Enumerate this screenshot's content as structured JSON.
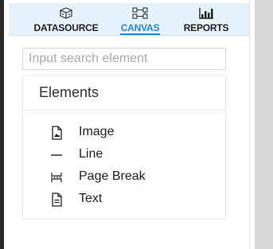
{
  "tabs": [
    {
      "id": "datasource",
      "label": "DATASOURCE",
      "icon": "database-icon",
      "active": false
    },
    {
      "id": "canvas",
      "label": "CANVAS",
      "icon": "flowchart-icon",
      "active": true
    },
    {
      "id": "reports",
      "label": "REPORTS",
      "icon": "bar-chart-icon",
      "active": false
    }
  ],
  "search": {
    "placeholder": "Input search element",
    "value": ""
  },
  "elements": {
    "title": "Elements",
    "items": [
      {
        "label": "Image",
        "icon": "image-file-icon"
      },
      {
        "label": "Line",
        "icon": "line-icon"
      },
      {
        "label": "Page Break",
        "icon": "page-break-icon"
      },
      {
        "label": "Text",
        "icon": "text-file-icon"
      }
    ]
  },
  "colors": {
    "accent": "#1e88e5",
    "tabbar_bg": "#e5f1fb",
    "gutter": "#d7d7d7"
  }
}
